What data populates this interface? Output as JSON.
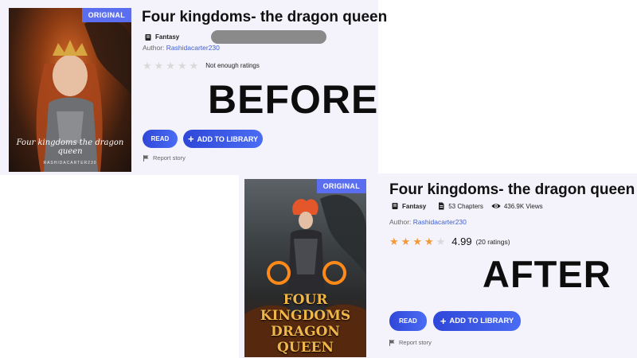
{
  "before": {
    "label": "BEFORE",
    "badge": "ORIGINAL",
    "title": "Four kingdoms- the dragon queen",
    "genre": "Fantasy",
    "author_prefix": "Author:",
    "author": "Rashidacarter230",
    "stars": {
      "filled": 0,
      "total": 5
    },
    "rating_note": "Not enough ratings",
    "read_label": "READ",
    "add_label": "ADD TO LIBRARY",
    "report_label": "Report story",
    "cover": {
      "script_title": "Four kingdoms the dragon queen",
      "author_caption": "RASHIDACARTER230"
    }
  },
  "after": {
    "label": "AFTER",
    "badge": "ORIGINAL",
    "title": "Four kingdoms- the dragon queen",
    "genre": "Fantasy",
    "chapters": "53 Chapters",
    "views": "436.9K Views",
    "author_prefix": "Author:",
    "author": "Rashidacarter230",
    "stars": {
      "filled": 4,
      "total": 5
    },
    "rating_value": "4.99",
    "rating_count": "(20 ratings)",
    "read_label": "READ",
    "add_label": "ADD TO LIBRARY",
    "report_label": "Report story",
    "cover": {
      "title_line1": "FOUR KINGDOMS",
      "title_line2": "DRAGON QUEEN"
    }
  },
  "colors": {
    "accent": "#3b5fd6",
    "star_filled": "#f29a38",
    "star_empty": "#d9d9d9",
    "badge": "#5b6ef0"
  },
  "icons": {
    "genre": "book-icon",
    "chapters": "document-icon",
    "views": "eye-icon",
    "report": "flag-icon",
    "add": "plus-icon",
    "star": "star-icon"
  }
}
